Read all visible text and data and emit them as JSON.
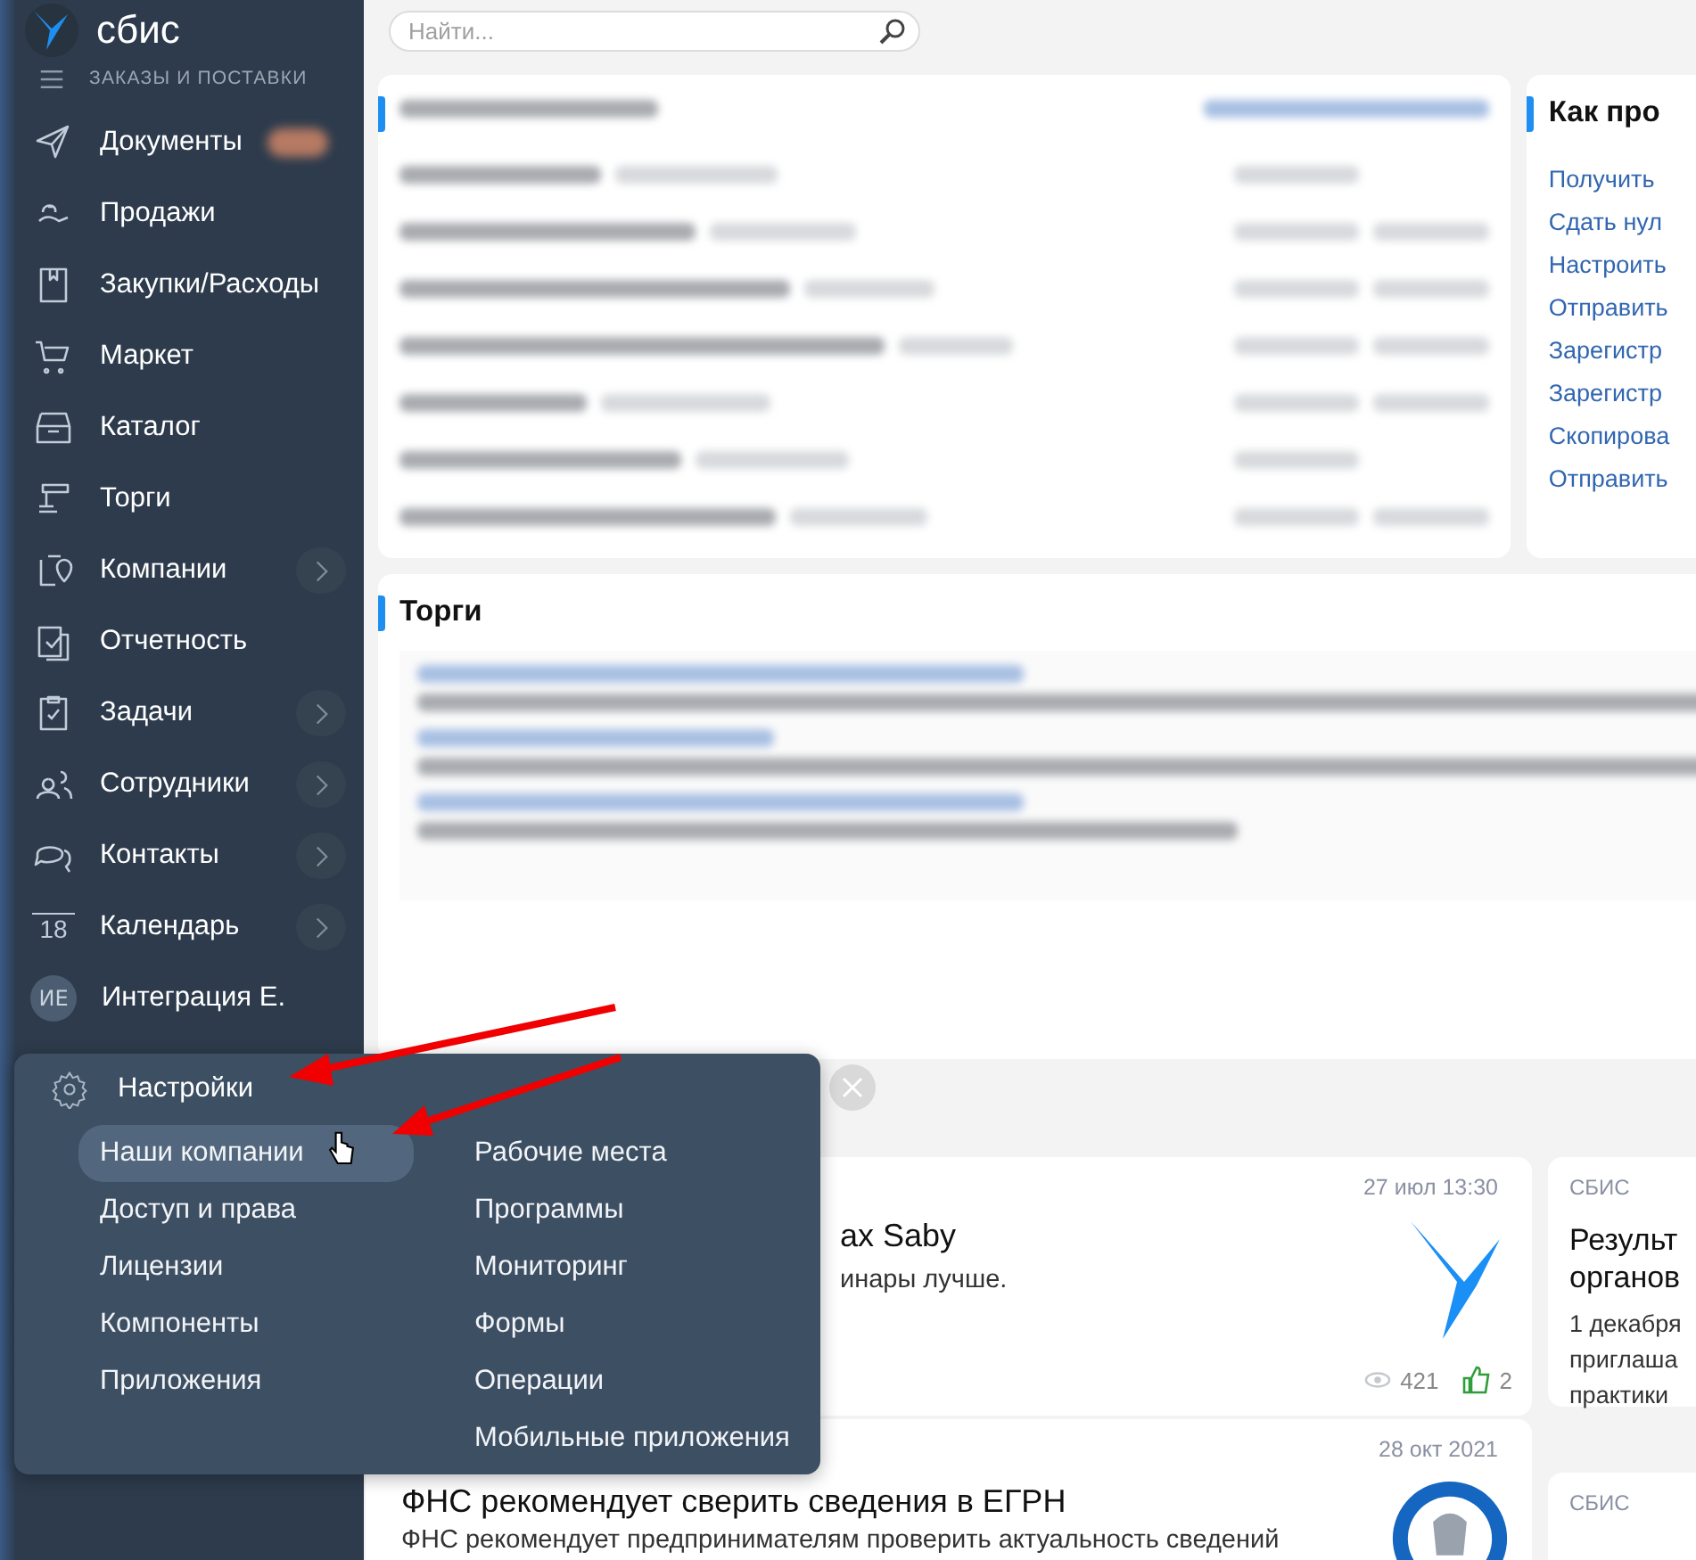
{
  "sidebar": {
    "logo": "сбис",
    "section": "ЗАКАЗЫ И ПОСТАВКИ",
    "items": [
      {
        "kind": "icon",
        "label": "Документы",
        "has_badge": true,
        "has_submenu": false
      },
      {
        "kind": "icon",
        "label": "Продажи",
        "has_badge": false,
        "has_submenu": false
      },
      {
        "kind": "icon",
        "label": "Закупки/Расходы",
        "has_badge": false,
        "has_submenu": false
      },
      {
        "kind": "icon",
        "label": "Маркет",
        "has_badge": false,
        "has_submenu": false
      },
      {
        "kind": "icon",
        "label": "Каталог",
        "has_badge": false,
        "has_submenu": false
      },
      {
        "kind": "icon",
        "label": "Торги",
        "has_badge": false,
        "has_submenu": false
      },
      {
        "kind": "icon",
        "label": "Компании",
        "has_badge": false,
        "has_submenu": true
      },
      {
        "kind": "icon",
        "label": "Отчетность",
        "has_badge": false,
        "has_submenu": false
      },
      {
        "kind": "icon",
        "label": "Задачи",
        "has_badge": false,
        "has_submenu": true
      },
      {
        "kind": "icon",
        "label": "Сотрудники",
        "has_badge": false,
        "has_submenu": true
      },
      {
        "kind": "icon",
        "label": "Контакты",
        "has_badge": false,
        "has_submenu": true
      },
      {
        "kind": "calendar",
        "day": "18",
        "label": "Календарь",
        "has_badge": false,
        "has_submenu": true
      },
      {
        "kind": "avatar",
        "initials": "ИЕ",
        "label": "Интеграция Е.",
        "has_badge": false,
        "has_submenu": false
      }
    ]
  },
  "search": {
    "placeholder": "Найти..."
  },
  "help_card": {
    "title": "Как про",
    "links": [
      "Получить",
      "Сдать нул",
      "Настроить",
      "Отправить",
      "Зарегистр",
      "Зарегистр",
      "Скопирова",
      "Отправить"
    ]
  },
  "torgi_card": {
    "title": "Торги"
  },
  "settings_menu": {
    "title": "Настройки",
    "columns": [
      [
        {
          "label": "Наши компании",
          "selected": true
        },
        {
          "label": "Доступ и права",
          "selected": false
        },
        {
          "label": "Лицензии",
          "selected": false
        },
        {
          "label": "Компоненты",
          "selected": false
        },
        {
          "label": "Приложения",
          "selected": false
        }
      ],
      [
        {
          "label": "Рабочие места",
          "selected": false
        },
        {
          "label": "Программы",
          "selected": false
        },
        {
          "label": "Мониторинг",
          "selected": false
        },
        {
          "label": "Формы",
          "selected": false
        },
        {
          "label": "Операции",
          "selected": false
        },
        {
          "label": "Мобильные приложения",
          "selected": false
        }
      ]
    ]
  },
  "news": [
    {
      "date": "27 июл 13:30",
      "title": "ах Saby",
      "text": "инары лучше.",
      "views": "421",
      "likes": "2"
    },
    {
      "date": "28 окт 2021",
      "title": "ФНС рекомендует сверить сведения в ЕГРН",
      "text": "ФНС рекомендует предпринимателям проверить актуальность сведений"
    }
  ],
  "side_news": [
    {
      "source": "СБИС",
      "title_lines": [
        "Результ",
        "органов"
      ],
      "text_lines": [
        "1 декабря",
        "приглаша",
        "практики"
      ]
    },
    {
      "source": "СБИС"
    }
  ]
}
